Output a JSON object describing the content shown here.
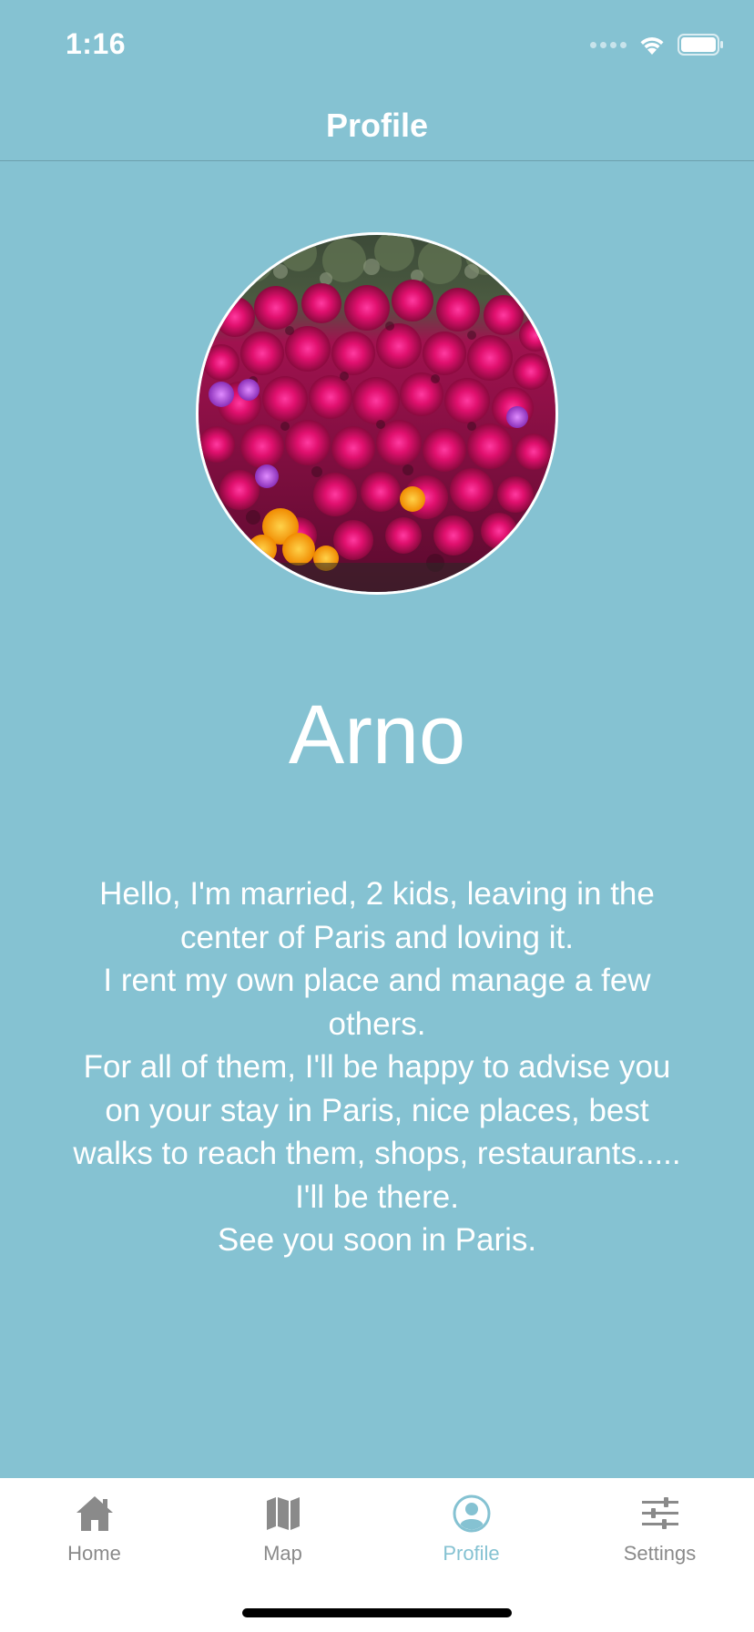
{
  "status_bar": {
    "time": "1:16"
  },
  "header": {
    "title": "Profile"
  },
  "profile": {
    "name": "Arno",
    "bio_lines": [
      "Hello, I'm married, 2 kids, leaving in the",
      "center of Paris and loving it.",
      "I rent my own place and manage a few",
      "others.",
      "For all of them, I'll be happy to advise you",
      "on your stay in Paris, nice places, best",
      "walks to reach them, shops, restaurants.....",
      "I'll be there.",
      "See you soon in Paris."
    ]
  },
  "tabs": [
    {
      "label": "Home",
      "icon": "house-icon",
      "active": false
    },
    {
      "label": "Map",
      "icon": "map-icon",
      "active": false
    },
    {
      "label": "Profile",
      "icon": "person-circle-icon",
      "active": true
    },
    {
      "label": "Settings",
      "icon": "sliders-icon",
      "active": false
    }
  ],
  "colors": {
    "background": "#85C2D2",
    "accent": "#85C2D2",
    "tab_inactive": "#8a8a8a",
    "tab_bar_bg": "#ffffff"
  }
}
